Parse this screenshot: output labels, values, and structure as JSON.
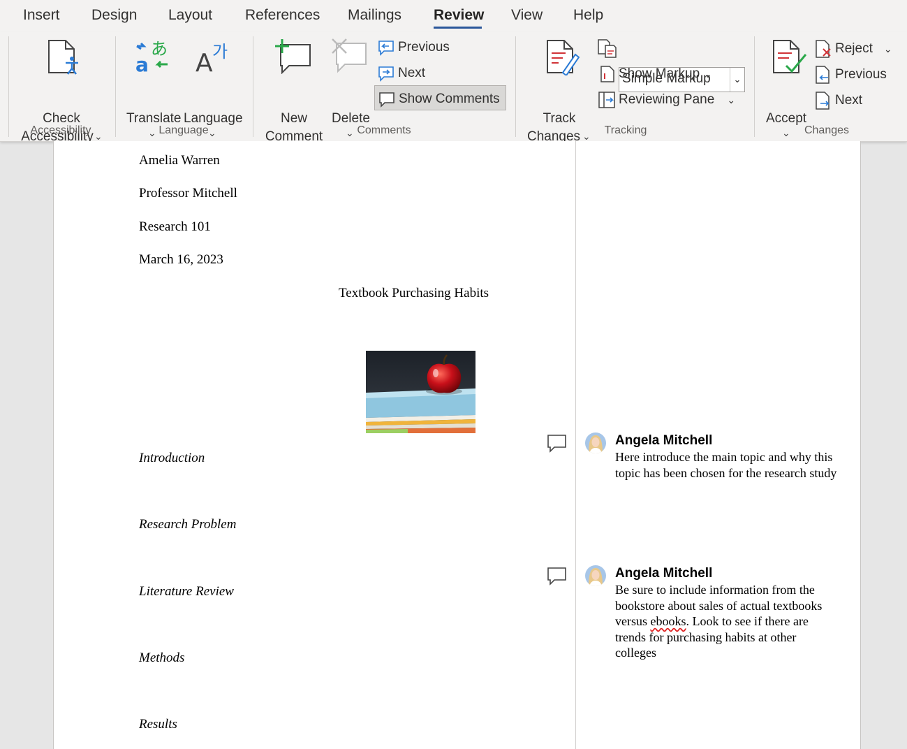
{
  "tabs": [
    {
      "label": "Insert",
      "active": false
    },
    {
      "label": "Design",
      "active": false
    },
    {
      "label": "Layout",
      "active": false
    },
    {
      "label": "References",
      "active": false
    },
    {
      "label": "Mailings",
      "active": false
    },
    {
      "label": "Review",
      "active": true
    },
    {
      "label": "View",
      "active": false
    },
    {
      "label": "Help",
      "active": false
    }
  ],
  "ribbon": {
    "accessibility": {
      "check_line1": "Check",
      "check_line2": "Accessibility",
      "group_label": "Accessibility"
    },
    "language": {
      "translate": "Translate",
      "language": "Language",
      "group_label": "Language"
    },
    "comments": {
      "new_line1": "New",
      "new_line2": "Comment",
      "delete": "Delete",
      "previous": "Previous",
      "next": "Next",
      "show_comments": "Show Comments",
      "group_label": "Comments"
    },
    "tracking": {
      "track_line1": "Track",
      "track_line2": "Changes",
      "markup_select": "Simple Markup",
      "show_markup": "Show Markup",
      "reviewing_pane": "Reviewing Pane",
      "group_label": "Tracking"
    },
    "changes": {
      "accept": "Accept",
      "reject": "Reject",
      "previous": "Previous",
      "next": "Next",
      "group_label": "Changes"
    }
  },
  "document": {
    "author_name": "Amelia Warren",
    "professor": "Professor Mitchell",
    "course": "Research 101",
    "date": "March 16, 2023",
    "title": "Textbook Purchasing Habits",
    "sections": [
      "Introduction",
      "Research Problem",
      "Literature Review",
      "Methods",
      "Results"
    ]
  },
  "comments": [
    {
      "author": "Angela Mitchell",
      "text": "Here introduce the main topic and why this topic has been chosen for the research study"
    },
    {
      "author": "Angela Mitchell",
      "text_before": "Be sure to include information from the bookstore about sales of actual textbooks versus ",
      "text_misspelled": "ebooks",
      "text_after": ".  Look to see if there are trends for purchasing habits at other colleges"
    }
  ],
  "colors": {
    "accent": "#2b579a",
    "ribbon_bg": "#f3f2f1",
    "canvas_bg": "#e6e6e6",
    "icon_blue": "#2b7bd5",
    "icon_green": "#2aa84a"
  }
}
